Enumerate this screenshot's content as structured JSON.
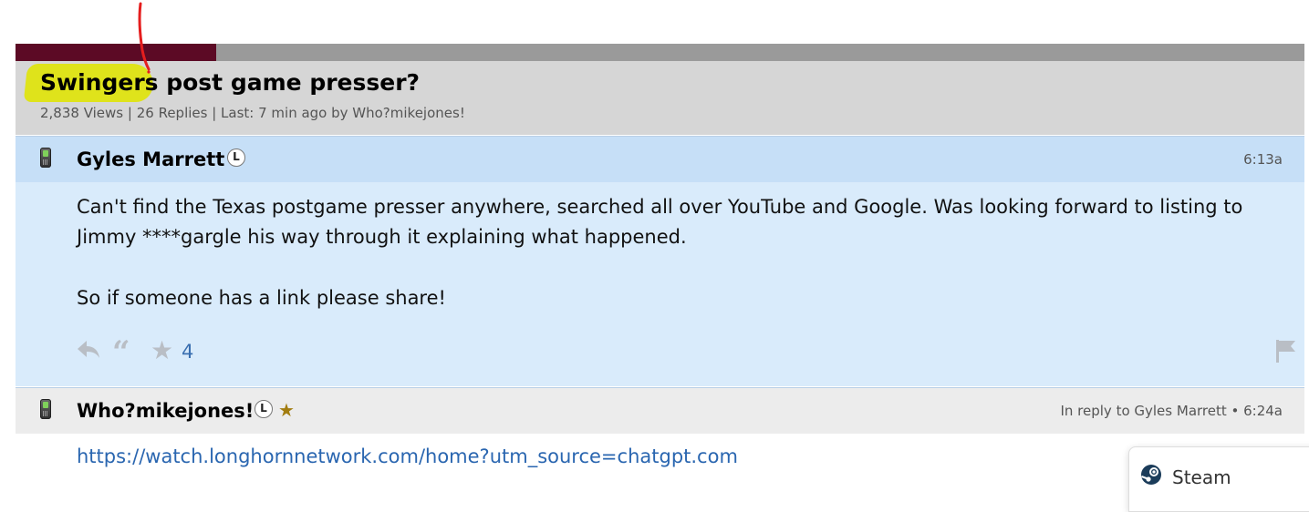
{
  "thread": {
    "title": "Swingers post game presser?",
    "meta": "2,838 Views | 26 Replies | Last: 7 min ago by Who?mikejones!"
  },
  "posts": [
    {
      "author": "Gyles Marrett",
      "badge": "L",
      "time": "6:13a",
      "body": [
        "Can't find the Texas postgame presser anywhere, searched all over YouTube and Google. Was looking forward to listing to Jimmy ****gargle his way through it explaining what happened.",
        "So if someone has a link please share!"
      ],
      "star_count": "4"
    },
    {
      "author": "Who?mikejones!",
      "badge": "L",
      "time": "In reply to Gyles Marrett • 6:24a",
      "link": "https://watch.longhornnetwork.com/home?utm_source=chatgpt.com"
    }
  ],
  "popup": {
    "label": "Steam"
  },
  "colors": {
    "brand": "#5c0a25",
    "highlight": "#dfe31b",
    "post_bg_highlighted": "#d9ebfb",
    "link": "#2a66b0",
    "gold_star": "#a27d10"
  },
  "icons": [
    "phone-icon",
    "reply-icon",
    "quote-icon",
    "star-icon",
    "flag-icon",
    "steam-icon"
  ]
}
